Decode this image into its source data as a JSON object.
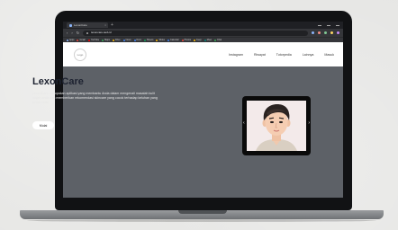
{
  "browser": {
    "tab_title": "LexonCare",
    "tab_close": "×",
    "new_tab": "+",
    "url": "lexoncare.web.id",
    "nav": {
      "back": "‹",
      "forward": "›",
      "reload": "↻"
    },
    "bookmarks": [
      "Apps",
      "Gmail",
      "YouTube",
      "Maps",
      "Drive",
      "News",
      "Docs",
      "Sheets",
      "Slides",
      "Calendar",
      "Photos",
      "Keep",
      "Meet",
      "Chat"
    ],
    "bookmark_colors": [
      "#8ab4f8",
      "#ea4335",
      "#ff0000",
      "#34a853",
      "#fbbc04",
      "#4285f4",
      "#4285f4",
      "#0f9d58",
      "#f4b400",
      "#4285f4",
      "#ea4335",
      "#fbbc04",
      "#00897b",
      "#34a853"
    ],
    "toolbar_dot_colors": [
      "#8ab4f8",
      "#f28b82",
      "#81c995",
      "#fdd663",
      "#c58af9"
    ]
  },
  "site": {
    "logo": "Logo",
    "menu": [
      "Instagram",
      "Riwayat",
      "Tutorpedia",
      "Lainnya",
      "Masuk"
    ],
    "hero": {
      "title": "LexonCare",
      "description": "LexonCare merupakan aplikasi yang membantu Anda dalam mengenali masalah kulit wajah anda dan memberikan rekomendasi skincare yang cocok terhadap keluhan yang Anda miliki.",
      "button": "Mulai"
    },
    "slider": {
      "prev": "‹",
      "next": "›",
      "image": "avatar-illustration"
    }
  },
  "colors": {
    "hero_bg": "#5d6167",
    "title": "#1d2230",
    "laptop": "#111214"
  }
}
